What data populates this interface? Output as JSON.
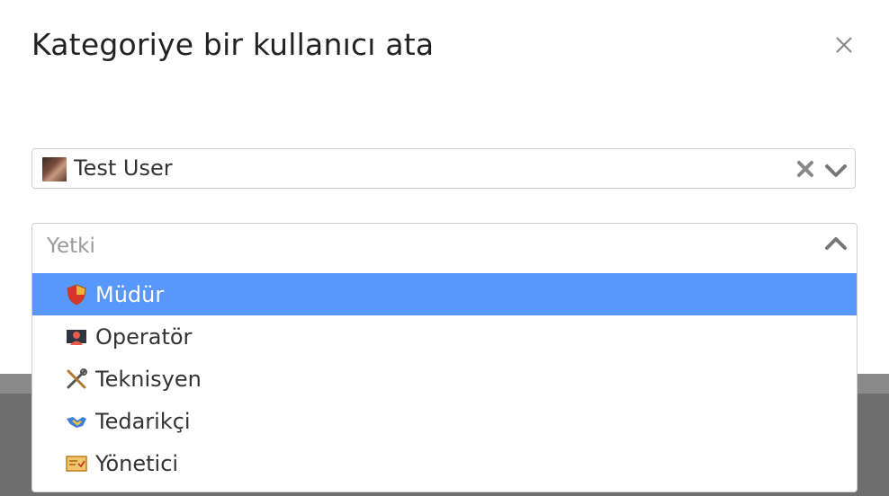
{
  "modal": {
    "title": "Kategoriye bir kullanıcı ata",
    "close_icon": "close-icon"
  },
  "user_select": {
    "value": "Test User",
    "avatar": "user-avatar",
    "clear_icon": "clear-icon",
    "toggle_icon": "chevron-down-icon"
  },
  "role_select": {
    "placeholder": "Yetki",
    "toggle_icon": "chevron-up-icon",
    "options": [
      {
        "label": "Müdür",
        "icon": "shield-icon",
        "selected": true
      },
      {
        "label": "Operatör",
        "icon": "monitor-user-icon",
        "selected": false
      },
      {
        "label": "Teknisyen",
        "icon": "tools-icon",
        "selected": false
      },
      {
        "label": "Tedarikçi",
        "icon": "handshake-icon",
        "selected": false
      },
      {
        "label": "Yönetici",
        "icon": "certificate-icon",
        "selected": false
      }
    ]
  },
  "colors": {
    "highlight": "#5897fb",
    "backdrop": "#6e6e6e"
  }
}
